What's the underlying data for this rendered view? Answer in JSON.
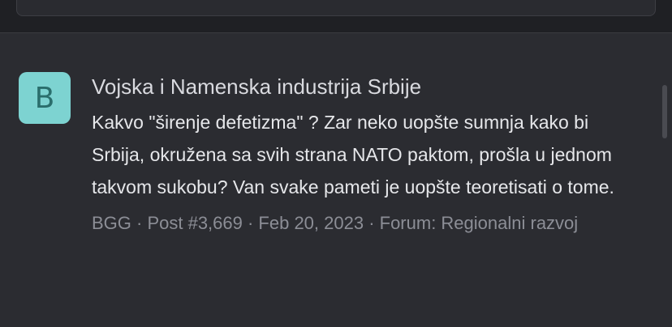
{
  "result": {
    "avatar_letter": "B",
    "title": "Vojska i Namenska industrija Srbije",
    "snippet": "Kakvo \"širenje defetizma\" ? Zar neko uopšte sumnja kako bi Srbija, okružena sa svih strana NATO paktom, prošla u jednom takvom sukobu? Van svake pameti je uopšte teoretisati o tome.",
    "meta": "BGG · Post #3,669 · Feb 20, 2023 · Forum: Regionalni razvoj"
  },
  "colors": {
    "background": "#2b2c31",
    "avatar_bg": "#7dd3d1",
    "avatar_text": "#2a6e6c",
    "title_text": "#d9dadf",
    "meta_text": "#8c8e96"
  }
}
